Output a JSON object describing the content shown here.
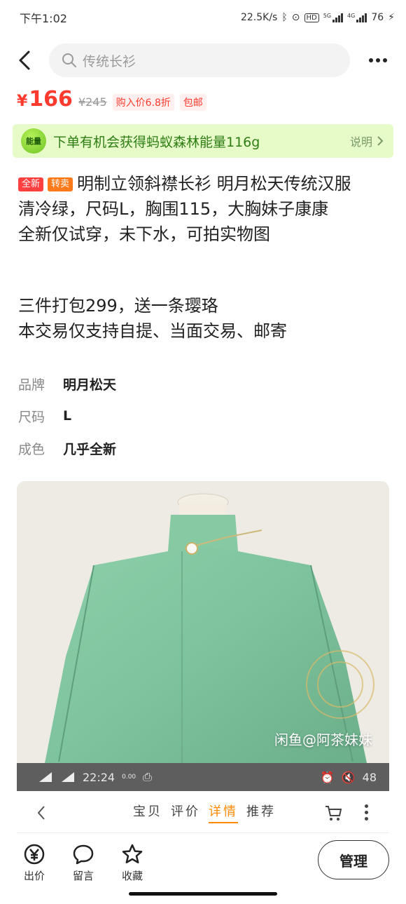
{
  "status_bar": {
    "time": "下午1:02",
    "speed": "22.5K/s",
    "net1": "5G",
    "net2": "4G",
    "battery": "76"
  },
  "search": {
    "placeholder": "传统长衫"
  },
  "price": {
    "currency": "¥",
    "current": "166",
    "original": "¥245",
    "discount_tag": "购入价6.8折",
    "shipping_tag": "包邮"
  },
  "energy_banner": {
    "icon_label": "能量",
    "text": "下单有机会获得蚂蚁森林能量116g",
    "link": "说明"
  },
  "listing": {
    "badge_new": "全新",
    "badge_resell": "转卖",
    "title": "明制立领斜襟长衫 明月松天传统汉服",
    "line1": "清冷绿，尺码L，胸围115，大胸妹子康康",
    "line2": "全新仅试穿，未下水，可拍实物图",
    "line3": "三件打包299，送一条璎珞",
    "line4": "本交易仅支持自提、当面交易、邮寄"
  },
  "specs": [
    {
      "key": "品牌",
      "value": "明月松天"
    },
    {
      "key": "尺码",
      "value": "L"
    },
    {
      "key": "成色",
      "value": "几乎全新"
    }
  ],
  "photo": {
    "watermark": "闲鱼@阿茶妹妹"
  },
  "embedded_status": {
    "time": "22:24",
    "speed": "0.00",
    "battery": "48"
  },
  "inner_nav": {
    "tabs": [
      "宝贝",
      "评价",
      "详情",
      "推荐"
    ],
    "active_tab": "详情"
  },
  "bottom_actions": [
    {
      "label": "出价",
      "icon": "yen-icon"
    },
    {
      "label": "留言",
      "icon": "chat-bubble-icon"
    },
    {
      "label": "收藏",
      "icon": "star-icon"
    }
  ],
  "manage_button": "管理",
  "colors": {
    "price_red": "#ff3b2f",
    "energy_green": "#2e7d14",
    "energy_bg": "#e7fbc8",
    "tab_active": "#ff8a00",
    "garment_green": "#7fbf9c"
  }
}
